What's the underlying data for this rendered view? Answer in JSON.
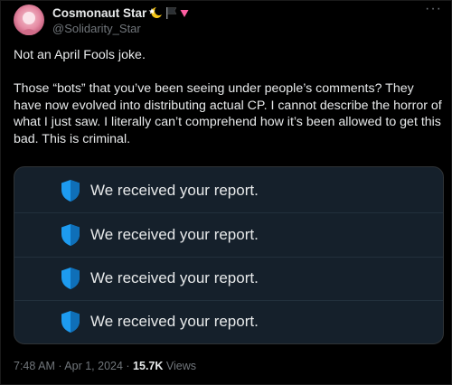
{
  "author": {
    "display_name": "Cosmonaut Star",
    "handle": "@Solidarity_Star",
    "avatar": "avatar-image",
    "badges": [
      "star-moon-emoji",
      "black-flag-emoji",
      "pink-triangle-emoji"
    ]
  },
  "menu": {
    "more_label": "···"
  },
  "tweet": {
    "paragraph_1": "Not an April Fools joke.",
    "paragraph_2": "Those “bots” that you’ve been seeing under people’s comments? They have now evolved into distributing actual CP. I cannot describe the horror of what I just saw. I literally can’t comprehend how it’s been allowed to get this bad. This is criminal."
  },
  "media": {
    "reports": [
      {
        "text": "We received your report.",
        "icon": "shield-check-icon"
      },
      {
        "text": "We received your report.",
        "icon": "shield-check-icon"
      },
      {
        "text": "We received your report.",
        "icon": "shield-check-icon"
      },
      {
        "text": "We received your report.",
        "icon": "shield-check-icon"
      }
    ]
  },
  "meta": {
    "time": "7:48 AM",
    "separator_1": " · ",
    "date": "Apr 1, 2024",
    "separator_2": " · ",
    "views_count": "15.7K",
    "views_label": " Views"
  },
  "colors": {
    "background": "#000000",
    "text_primary": "#e7e9ea",
    "text_secondary": "#71767b",
    "card_background": "#15202b",
    "shield_blue": "#1d9bf0"
  }
}
